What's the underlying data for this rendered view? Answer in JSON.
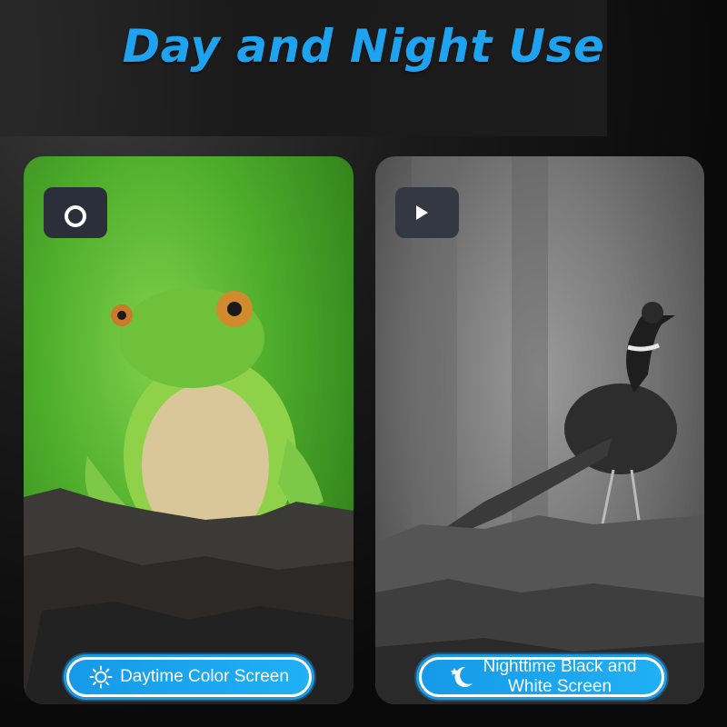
{
  "title": "Day and Night Use",
  "day_panel": {
    "icon": "camera-icon",
    "caption": "Daytime Color Screen",
    "caption_icon": "sun-icon"
  },
  "night_panel": {
    "icon": "video-camera-icon",
    "caption_line1": "Nighttime Black and",
    "caption_line2": "White Screen",
    "caption_icon": "moon-star-icon"
  },
  "colors": {
    "accent_blue": "#1ea3f0",
    "pill_blue": "#169ae8",
    "background": "#0b0b0c"
  }
}
